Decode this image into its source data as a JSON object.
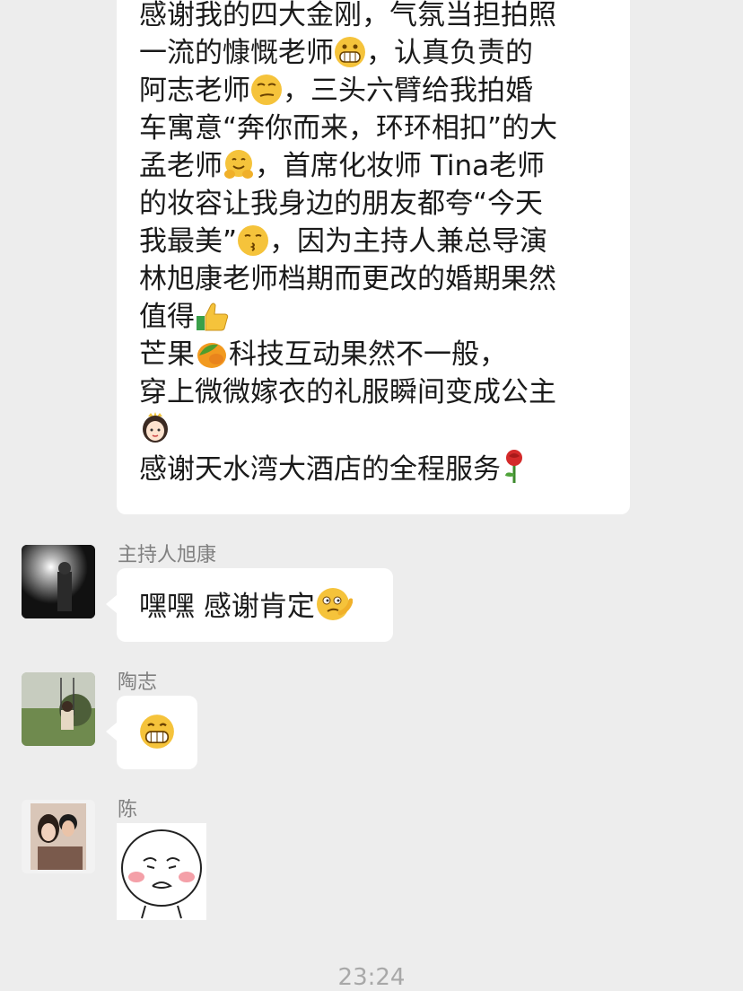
{
  "messages": {
    "long_text": {
      "lines": [
        "感谢我的四大金刚，气氛当担拍照",
        "一流的慷慨老师",
        "，认真负责的",
        "阿志老师",
        "，三头六臂给我拍婚",
        "车寓意“奔你而来，环环相扣”的大",
        "孟老师",
        "，首席化妆师 Tina老师",
        "的妆容让我身边的朋友都夸“今天",
        "我最美”",
        "，因为主持人兼总导演",
        "林旭康老师档期而更改的婚期果然",
        "值得",
        "芒果",
        "科技互动果然不一般，",
        "穿上微微嫁衣的礼服瞬间变成公主",
        "感谢天水湾大酒店的全程服务"
      ]
    },
    "xukang": {
      "sender": "主持人旭康",
      "text": "嘿嘿 感谢肯定"
    },
    "taozhi": {
      "sender": "陶志"
    },
    "chen": {
      "sender": "陈"
    }
  },
  "timestamp": "23:24",
  "icons": [
    "grinning-emoji-icon",
    "smirk-emoji-icon",
    "hug-emoji-icon",
    "kissing-emoji-icon",
    "thumbs-up-emoji-icon",
    "mango-emoji-icon",
    "princess-emoji-icon",
    "rose-emoji-icon",
    "shy-emoji-icon",
    "meme-sticker-icon"
  ]
}
